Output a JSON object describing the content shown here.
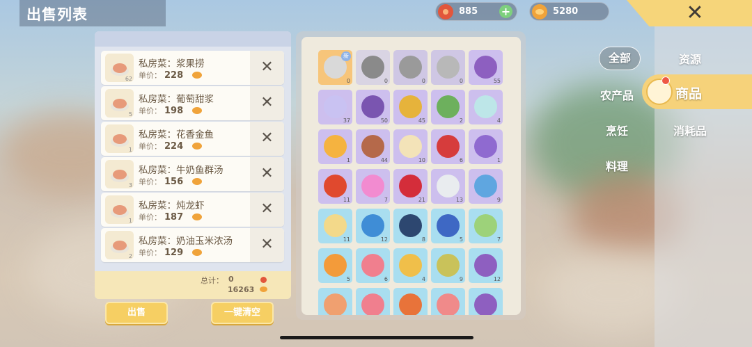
{
  "header": {
    "title": "出售列表"
  },
  "currencies": [
    {
      "name": "gem-icon",
      "value": "885",
      "color": "#e2563b"
    },
    {
      "name": "coin-icon",
      "value": "5280",
      "color": "#f0a33a"
    }
  ],
  "close_label": "✕",
  "sale_list": [
    {
      "name": "私房菜：浆果捞",
      "price_label": "单价：",
      "price": "228",
      "count": "62",
      "icon": "berry-dessert-icon"
    },
    {
      "name": "私房菜：葡萄甜浆",
      "price_label": "单价：",
      "price": "198",
      "count": "5",
      "icon": "grape-drink-icon"
    },
    {
      "name": "私房菜：花香金鱼",
      "price_label": "单价：",
      "price": "224",
      "count": "1",
      "icon": "fish-dish-icon"
    },
    {
      "name": "私房菜：牛奶鱼群汤",
      "price_label": "单价：",
      "price": "156",
      "count": "3",
      "icon": "fish-soup-icon"
    },
    {
      "name": "私房菜：炖龙虾",
      "price_label": "单价：",
      "price": "187",
      "count": "1",
      "icon": "lobster-icon"
    },
    {
      "name": "私房菜：奶油玉米浓汤",
      "price_label": "单价：",
      "price": "129",
      "count": "2",
      "icon": "corn-soup-icon"
    }
  ],
  "remove_label": "✕",
  "totals": {
    "label": "总计：",
    "count": "0",
    "amount": "16263"
  },
  "buttons": {
    "sell": "出售",
    "clear_all": "一键清空"
  },
  "new_badge": "新",
  "inventory": [
    [
      {
        "icon": "cooking-pot-icon",
        "count": "0",
        "bg": "#f7c57a",
        "art": "#d9d9d9"
      },
      {
        "icon": "mortar-icon",
        "count": "0",
        "bg": "#d9d4e3",
        "art": "#8a8a8a"
      },
      {
        "icon": "dark-dish-icon",
        "count": "0",
        "bg": "#cfc7e4",
        "art": "#9a9a9a"
      },
      {
        "icon": "grey-pot-icon",
        "count": "0",
        "bg": "#cfc7e4",
        "art": "#b8b8b8"
      },
      {
        "icon": "purple-bundle-icon",
        "count": "55",
        "bg": "#cdbfee",
        "art": "#8d5fc0"
      }
    ],
    [
      {
        "icon": "crystal-icon",
        "count": "37",
        "bg": "#cdbfee",
        "art": "#c9c2f2"
      },
      {
        "icon": "purple-log-icon",
        "count": "50",
        "bg": "#cdbfee",
        "art": "#7a55b0"
      },
      {
        "icon": "gold-ore-icon",
        "count": "45",
        "bg": "#cdbfee",
        "art": "#e6b33b"
      },
      {
        "icon": "frog-icon",
        "count": "2",
        "bg": "#cdbfee",
        "art": "#6db05d"
      },
      {
        "icon": "koala-icon",
        "count": "4",
        "bg": "#cdbfee",
        "art": "#bde6e8"
      }
    ],
    [
      {
        "icon": "goldfish-flower-icon",
        "count": "1",
        "bg": "#cdbfee",
        "art": "#f5b340"
      },
      {
        "icon": "seed-bag-icon",
        "count": "44",
        "bg": "#cdbfee",
        "art": "#b5694a"
      },
      {
        "icon": "dough-icon",
        "count": "10",
        "bg": "#cdbfee",
        "art": "#f3e3b8"
      },
      {
        "icon": "red-flower-icon",
        "count": "6",
        "bg": "#cdbfee",
        "art": "#d63c3c"
      },
      {
        "icon": "lavender-icon",
        "count": "1",
        "bg": "#cdbfee",
        "art": "#8f6ad0"
      }
    ],
    [
      {
        "icon": "tomato-icon",
        "count": "11",
        "bg": "#cdbfee",
        "art": "#e0492e"
      },
      {
        "icon": "rainbow-flower-icon",
        "count": "7",
        "bg": "#cdbfee",
        "art": "#f28bd0"
      },
      {
        "icon": "red-berry-icon",
        "count": "21",
        "bg": "#cdbfee",
        "art": "#d42d3a"
      },
      {
        "icon": "stone-icon",
        "count": "13",
        "bg": "#cdbfee",
        "art": "#e9ecef"
      },
      {
        "icon": "blue-fish-icon",
        "count": "9",
        "bg": "#cdbfee",
        "art": "#5fa6e0"
      }
    ],
    [
      {
        "icon": "yellow-fish-icon",
        "count": "11",
        "bg": "#a9def0",
        "art": "#f3d98a"
      },
      {
        "icon": "blue-fish-icon",
        "count": "12",
        "bg": "#a9def0",
        "art": "#3f8dd6"
      },
      {
        "icon": "penguin-icon",
        "count": "8",
        "bg": "#a9def0",
        "art": "#2d4770"
      },
      {
        "icon": "red-blue-fish-icon",
        "count": "5",
        "bg": "#a9def0",
        "art": "#3e68c4"
      },
      {
        "icon": "green-fish-icon",
        "count": "7",
        "bg": "#a9def0",
        "art": "#9dd27a"
      }
    ],
    [
      {
        "icon": "goldfish-icon",
        "count": "5",
        "bg": "#a9def0",
        "art": "#f39b3a"
      },
      {
        "icon": "pink-fish-icon",
        "count": "6",
        "bg": "#a9def0",
        "art": "#f07f8e"
      },
      {
        "icon": "yellow-fish-icon",
        "count": "4",
        "bg": "#a9def0",
        "art": "#f0bf4a"
      },
      {
        "icon": "striped-fish-icon",
        "count": "9",
        "bg": "#a9def0",
        "art": "#c9c25a"
      },
      {
        "icon": "purple-fish-icon",
        "count": "12",
        "bg": "#a9def0",
        "art": "#8e5fc0"
      }
    ],
    [
      {
        "icon": "shrimp-icon",
        "count": "",
        "bg": "#a9def0",
        "art": "#f0a070"
      },
      {
        "icon": "pink-fish-icon",
        "count": "",
        "bg": "#a9def0",
        "art": "#f07f8e"
      },
      {
        "icon": "orange-fish-icon",
        "count": "",
        "bg": "#a9def0",
        "art": "#e8733a"
      },
      {
        "icon": "octopus-icon",
        "count": "",
        "bg": "#a9def0",
        "art": "#f08a8a"
      },
      {
        "icon": "frame-icon",
        "count": "",
        "bg": "#a9def0",
        "art": "#8e5fc0"
      }
    ]
  ],
  "categories": {
    "left": [
      "全部",
      "农产品",
      "烹饪",
      "料理"
    ],
    "right": [
      "资源",
      "商品",
      "消耗品"
    ],
    "selected": "商品"
  }
}
